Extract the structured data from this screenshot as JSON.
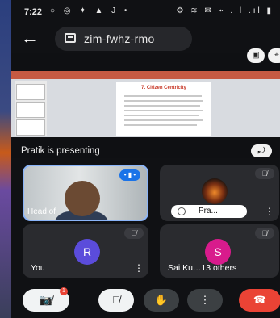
{
  "status": {
    "time": "7:22",
    "left_icons": "○ ◎ ✦ ▲ J •",
    "right_icons": "⚙ ≋ ✉ ⌁ .ıl .ıl ▮"
  },
  "meeting": {
    "code": "zim-fwhz-rmo"
  },
  "top_actions": {
    "right_cut_icon": "camera-switch"
  },
  "slide": {
    "title": "7. Citizen Centricity"
  },
  "presenter_text": "Pratik is presenting",
  "tiles": [
    {
      "name": "Head of"
    },
    {
      "name": "Pra..."
    },
    {
      "name": "You",
      "initial": "R",
      "color": "#5b4cdb"
    },
    {
      "name": "Sai Ku…13 others",
      "initial": "S",
      "color": "#d81b8c"
    }
  ],
  "controls": {
    "cam_badge": "1"
  },
  "colors": {
    "accent": "#1a73e8",
    "end_call": "#ea4335"
  }
}
